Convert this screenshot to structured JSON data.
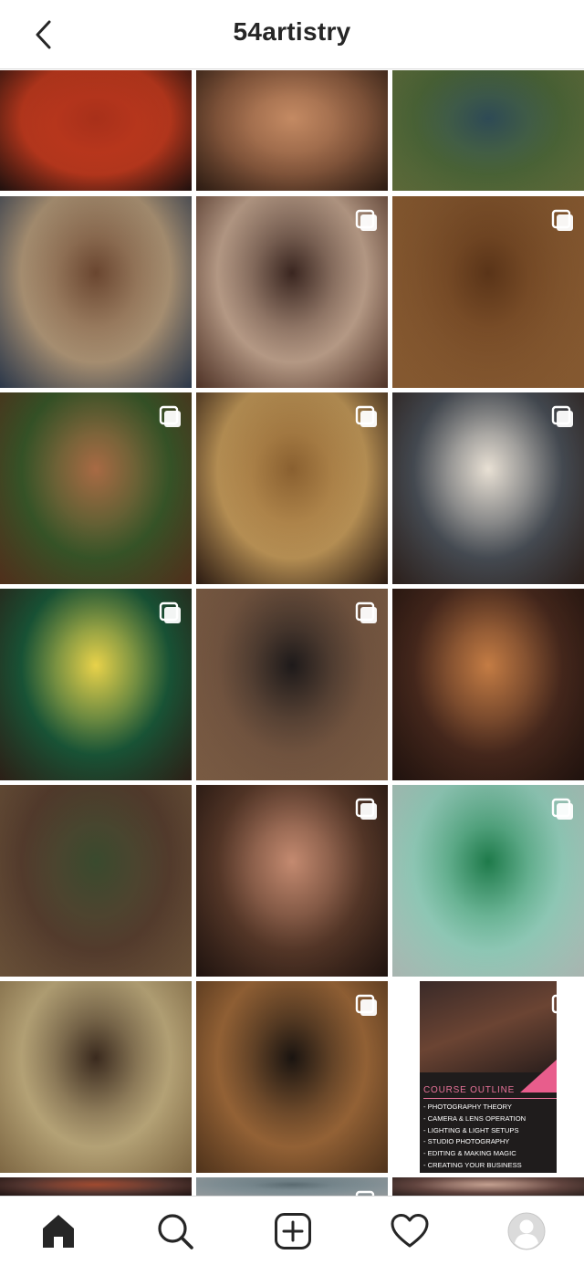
{
  "header": {
    "title": "54artistry",
    "back_icon": "chevron-left-icon"
  },
  "grid": {
    "tiles": [
      {
        "row": 1,
        "col": 1,
        "multi": false,
        "colors": [
          "#c13a1e",
          "#a8301a",
          "#2a1612"
        ]
      },
      {
        "row": 1,
        "col": 2,
        "multi": false,
        "colors": [
          "#8a5a3e",
          "#c48a63",
          "#3a2418"
        ]
      },
      {
        "row": 1,
        "col": 3,
        "multi": false,
        "colors": [
          "#4f6a3a",
          "#2e4a55",
          "#7a8a4a"
        ]
      },
      {
        "row": 2,
        "col": 1,
        "multi": false,
        "colors": [
          "#b49a7a",
          "#6a4630",
          "#3a4a62"
        ]
      },
      {
        "row": 2,
        "col": 2,
        "multi": true,
        "colors": [
          "#c4a690",
          "#3a2620",
          "#6a4434"
        ]
      },
      {
        "row": 2,
        "col": 3,
        "multi": true,
        "colors": [
          "#8a5a30",
          "#5a3418",
          "#b07640"
        ]
      },
      {
        "row": 3,
        "col": 1,
        "multi": true,
        "colors": [
          "#3a5a2a",
          "#a86a44",
          "#6a3e24"
        ]
      },
      {
        "row": 3,
        "col": 2,
        "multi": true,
        "colors": [
          "#c49a5a",
          "#8a6030",
          "#3a2418"
        ]
      },
      {
        "row": 3,
        "col": 3,
        "multi": true,
        "colors": [
          "#4a5058",
          "#e8e0d4",
          "#3a2a24"
        ]
      },
      {
        "row": 4,
        "col": 1,
        "multi": true,
        "colors": [
          "#1a5a3a",
          "#e8d24a",
          "#3a2a1e"
        ]
      },
      {
        "row": 4,
        "col": 2,
        "multi": true,
        "colors": [
          "#7a5a44",
          "#1e1a1a",
          "#a07858"
        ]
      },
      {
        "row": 4,
        "col": 3,
        "multi": false,
        "colors": [
          "#4a2a1e",
          "#c47c44",
          "#2a1812"
        ]
      },
      {
        "row": 5,
        "col": 1,
        "multi": false,
        "colors": [
          "#5a4030",
          "#3a4a2e",
          "#8a6a4a"
        ]
      },
      {
        "row": 5,
        "col": 2,
        "multi": true,
        "colors": [
          "#5a3a2a",
          "#c48a70",
          "#2a1a14"
        ]
      },
      {
        "row": 5,
        "col": 3,
        "multi": true,
        "colors": [
          "#9ad8c4",
          "#1e7a4a",
          "#e0f0ea"
        ]
      },
      {
        "row": 6,
        "col": 1,
        "multi": false,
        "colors": [
          "#c4b080",
          "#3a2a1e",
          "#a88a5a"
        ]
      },
      {
        "row": 6,
        "col": 2,
        "multi": true,
        "colors": [
          "#a06a3a",
          "#1a1410",
          "#6a4424"
        ]
      },
      {
        "row": 6,
        "col": 3,
        "multi": true,
        "type": "course"
      },
      {
        "row": 7,
        "col": 1,
        "multi": false,
        "colors": [
          "#5a3a34",
          "#a04a30",
          "#2a1a18"
        ]
      },
      {
        "row": 7,
        "col": 2,
        "multi": true,
        "colors": [
          "#8a9aa0",
          "#5a6a70",
          "#c0c8cc"
        ]
      },
      {
        "row": 7,
        "col": 3,
        "multi": false,
        "colors": [
          "#6a4a44",
          "#c4a090",
          "#3a2a26"
        ]
      }
    ]
  },
  "course": {
    "heading": "COURSE OUTLINE",
    "items": [
      "- PHOTOGRAPHY THEORY",
      "- CAMERA & LENS  OPERATION",
      "- LIGHTING & LIGHT SETUPS",
      "- STUDIO PHOTOGRAPHY",
      "- EDITING & MAKING MAGIC",
      "- CREATING YOUR BUSINESS"
    ],
    "accent": "#e8739a"
  },
  "bottom_nav": {
    "items": [
      {
        "name": "home",
        "icon": "home-icon",
        "active": true
      },
      {
        "name": "search",
        "icon": "search-icon"
      },
      {
        "name": "new-post",
        "icon": "plus-square-icon"
      },
      {
        "name": "activity",
        "icon": "heart-icon"
      },
      {
        "name": "profile",
        "icon": "avatar-icon"
      }
    ]
  }
}
